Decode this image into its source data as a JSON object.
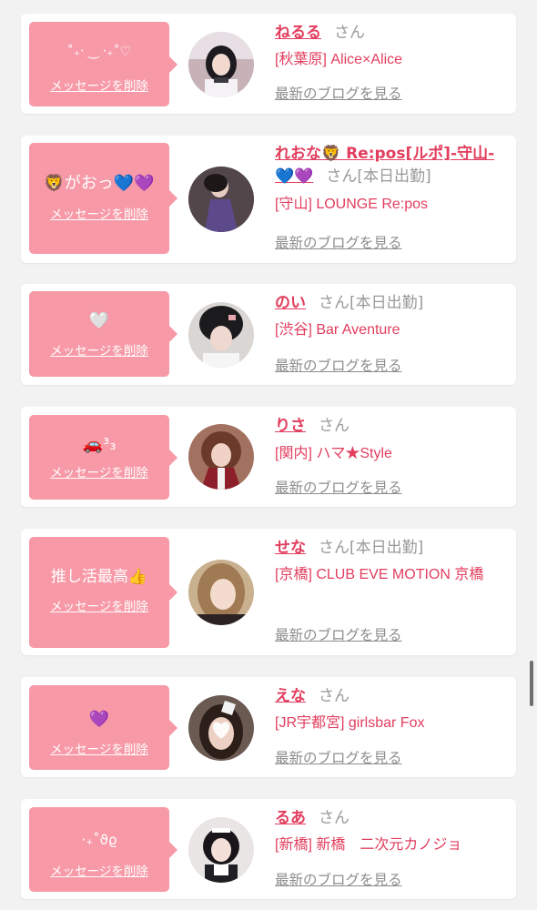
{
  "common": {
    "delete_label": "メッセージを削除",
    "blog_label": "最新のブログを見る",
    "san": "さん"
  },
  "colors": {
    "bubble": "#f799a7",
    "name": "#e23e5e",
    "card": "#ffffff",
    "background": "#f2f2f3"
  },
  "cards": [
    {
      "message": "˚₊‧ ‿ ‧₊˚♡",
      "name": "ねるる",
      "status": "",
      "shop": "[秋葉原] Alice×Alice"
    },
    {
      "message": "🦁がおっ💙💜",
      "name": "れおな🦁 Re:pos[ルポ]-守山-💙💜",
      "status": "[本日出勤]",
      "shop": "[守山] LOUNGE Re:pos"
    },
    {
      "message": "🤍",
      "name": "のい",
      "status": "[本日出勤]",
      "shop": "[渋谷] Bar Aventure"
    },
    {
      "message": "🚗³₃",
      "name": "りさ",
      "status": "",
      "shop": "[関内] ハマ★Style"
    },
    {
      "message": "推し活最高👍",
      "name": "せな",
      "status": "[本日出勤]",
      "shop": "[京橋] CLUB EVE MOTION 京橋"
    },
    {
      "message": "💜",
      "name": "えな",
      "status": "",
      "shop": "[JR宇都宮] girlsbar Fox"
    },
    {
      "message": "‧₊˚ϑϱ",
      "name": "るあ",
      "status": "",
      "shop": "[新橋] 新橋　二次元カノジョ"
    }
  ]
}
